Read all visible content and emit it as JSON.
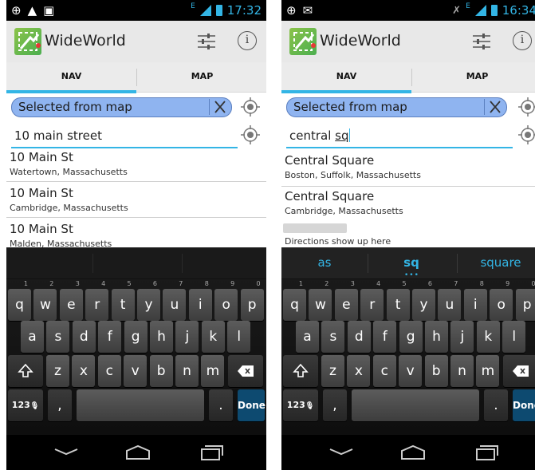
{
  "app": {
    "title": "WideWorld"
  },
  "tabs": {
    "nav": "NAV",
    "map": "MAP"
  },
  "colors": {
    "accent": "#33b5e5",
    "chip": "#8fb4f0",
    "done_key": "#0d4a70"
  },
  "icons": [
    "alarm-icon",
    "warning-icon",
    "image-icon",
    "gps-icon",
    "mail-icon",
    "mute-icon",
    "signal-icon",
    "battery-icon",
    "settings-sliders-icon",
    "info-icon",
    "locate-icon",
    "clear-icon",
    "shift-icon",
    "backspace-icon",
    "mic-icon",
    "back-icon",
    "home-icon",
    "recents-icon"
  ],
  "keyboard": {
    "row1": [
      "q",
      "w",
      "e",
      "r",
      "t",
      "y",
      "u",
      "i",
      "o",
      "p"
    ],
    "row1_hints": [
      "1",
      "2",
      "3",
      "4",
      "5",
      "6",
      "7",
      "8",
      "9",
      "0"
    ],
    "row2": [
      "a",
      "s",
      "d",
      "f",
      "g",
      "h",
      "j",
      "k",
      "l"
    ],
    "row3": [
      "z",
      "x",
      "c",
      "v",
      "b",
      "n",
      "m"
    ],
    "symbols": "123",
    "comma": ",",
    "period": ".",
    "done": "Done"
  },
  "phone1": {
    "clock": "17:32",
    "from_chip": "Selected from map",
    "to_input": "10 main street",
    "suggestions": [
      {
        "title": "10 Main St",
        "subtitle": "Watertown, Massachusetts"
      },
      {
        "title": "10 Main St",
        "subtitle": "Cambridge, Massachusetts"
      },
      {
        "title": "10 Main St",
        "subtitle": "Malden, Massachusetts"
      }
    ]
  },
  "phone2": {
    "clock": "16:34",
    "from_chip": "Selected from map",
    "to_input_prefix": "central ",
    "to_input_word": "sq",
    "suggestions": [
      {
        "title": "Central Square",
        "subtitle": "Boston, Suffolk, Massachusetts"
      },
      {
        "title": "Central Square",
        "subtitle": "Cambridge, Massachusetts"
      }
    ],
    "directions_text": "Directions show up here",
    "word_suggestions": [
      "as",
      "sq",
      "square"
    ]
  }
}
